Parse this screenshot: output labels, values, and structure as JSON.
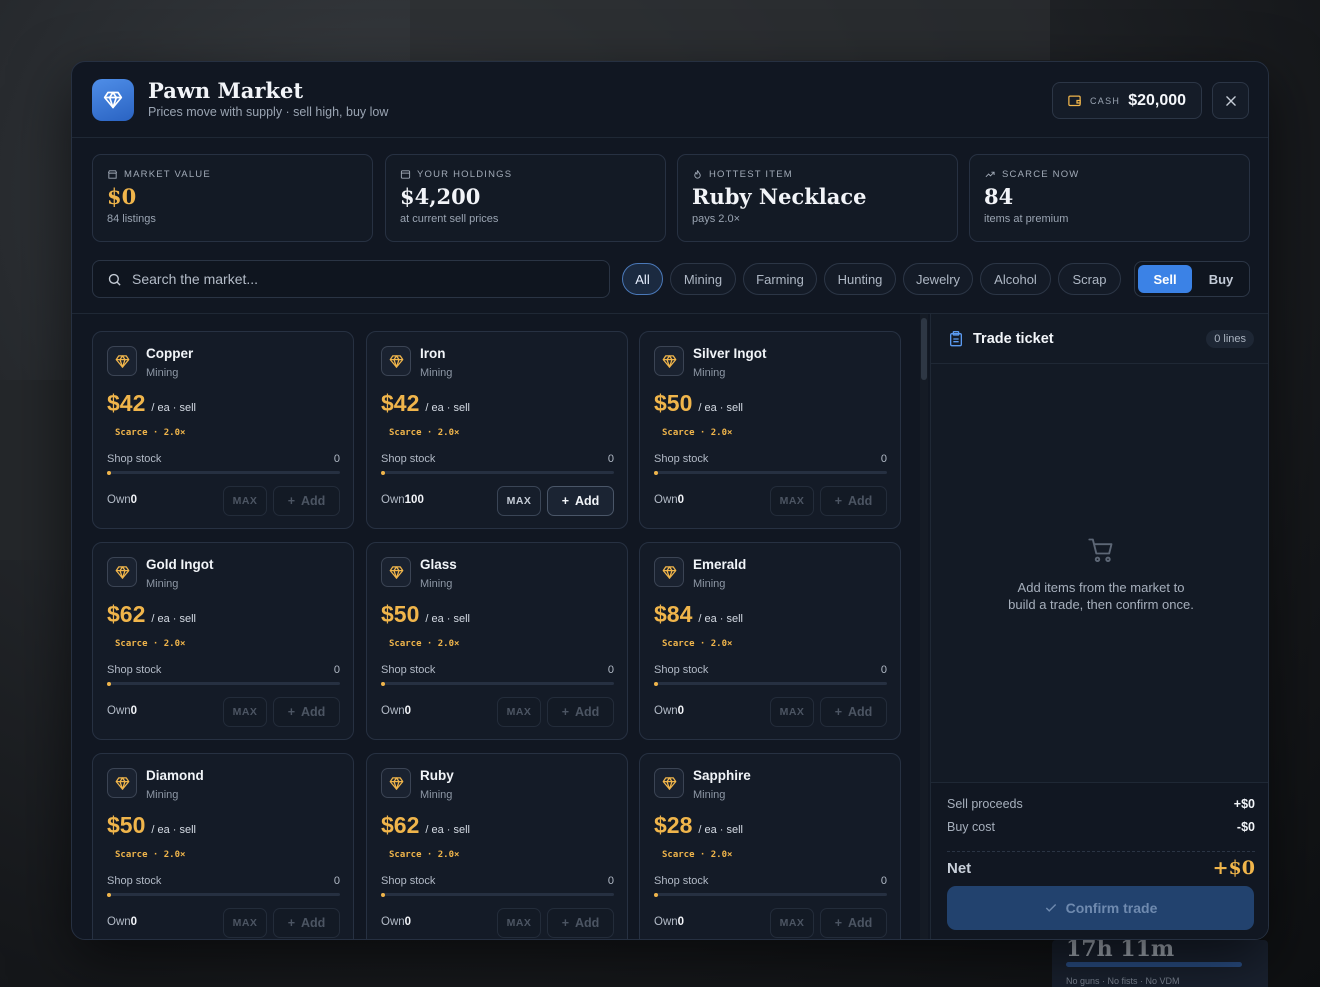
{
  "header": {
    "title": "Pawn Market",
    "subtitle": "Prices move with supply · sell high, buy low",
    "cash_label": "CASH",
    "cash_value": "$20,000"
  },
  "stats": [
    {
      "label": "MARKET VALUE",
      "value": "$0",
      "sub": "84 listings",
      "icon": "store-icon"
    },
    {
      "label": "YOUR HOLDINGS",
      "value": "$4,200",
      "sub": "at current sell prices",
      "icon": "box-icon"
    },
    {
      "label": "HOTTEST ITEM",
      "value": "Ruby Necklace",
      "sub": "pays 2.0×",
      "icon": "flame-icon"
    },
    {
      "label": "SCARCE NOW",
      "value": "84",
      "sub": "items at premium",
      "icon": "trending-up-icon"
    }
  ],
  "search": {
    "placeholder": "Search the market..."
  },
  "filters": [
    "All",
    "Mining",
    "Farming",
    "Hunting",
    "Jewelry",
    "Alcohol",
    "Scrap"
  ],
  "active_filter": "All",
  "mode": {
    "sell": "Sell",
    "buy": "Buy",
    "active": "Sell"
  },
  "card_labels": {
    "unit": "/ ea · sell",
    "scarce": "Scarce · 2.0×",
    "stock": "Shop stock",
    "own": "Own",
    "max": "MAX",
    "add": "Add"
  },
  "items": [
    {
      "name": "Copper",
      "category": "Mining",
      "price": "$42",
      "stock": "0",
      "own": "0"
    },
    {
      "name": "Iron",
      "category": "Mining",
      "price": "$42",
      "stock": "0",
      "own": "100"
    },
    {
      "name": "Silver Ingot",
      "category": "Mining",
      "price": "$50",
      "stock": "0",
      "own": "0"
    },
    {
      "name": "Gold Ingot",
      "category": "Mining",
      "price": "$62",
      "stock": "0",
      "own": "0"
    },
    {
      "name": "Glass",
      "category": "Mining",
      "price": "$50",
      "stock": "0",
      "own": "0"
    },
    {
      "name": "Emerald",
      "category": "Mining",
      "price": "$84",
      "stock": "0",
      "own": "0"
    },
    {
      "name": "Diamond",
      "category": "Mining",
      "price": "$50",
      "stock": "0",
      "own": "0"
    },
    {
      "name": "Ruby",
      "category": "Mining",
      "price": "$62",
      "stock": "0",
      "own": "0"
    },
    {
      "name": "Sapphire",
      "category": "Mining",
      "price": "$28",
      "stock": "0",
      "own": "0"
    }
  ],
  "ticket": {
    "title": "Trade ticket",
    "count": "0 lines",
    "empty_line1": "Add items from the market to",
    "empty_line2": "build a trade, then confirm once.",
    "sell_label": "Sell proceeds",
    "sell_value": "+$0",
    "buy_label": "Buy cost",
    "buy_value": "-$0",
    "net_label": "Net",
    "net_value": "+$0",
    "confirm": "Confirm trade"
  },
  "colors": {
    "accent": "#3b82e6",
    "gold": "#f0b54b",
    "panel": "#111722"
  },
  "background_hud": {
    "title": "17h 11m",
    "sub": "No guns · No fists · No VDM"
  }
}
